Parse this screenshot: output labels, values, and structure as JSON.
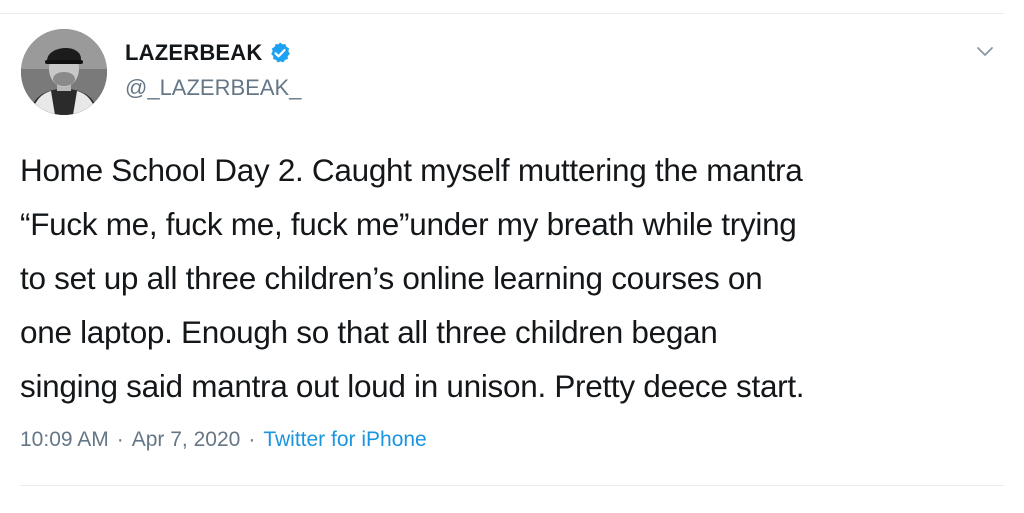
{
  "user": {
    "display_name": "LAZERBEAK",
    "handle": "@_LAZERBEAK_",
    "verified": true
  },
  "tweet": {
    "lines": [
      "Home School Day 2. Caught myself muttering the mantra",
      "“Fuck me, fuck me, fuck me”under my breath while trying",
      "to set up all three children’s online learning courses on",
      "one laptop. Enough so that all three children began",
      "singing said mantra out loud in unison. Pretty deece start."
    ]
  },
  "meta": {
    "time": "10:09 AM",
    "separator": "·",
    "date": "Apr 7, 2020",
    "separator2": "·",
    "source": "Twitter for iPhone"
  },
  "icons": {
    "verified": "verified-badge-icon",
    "menu": "chevron-down-icon"
  },
  "colors": {
    "text": "#14171a",
    "secondary": "#657786",
    "link": "#1b95e0",
    "verified": "#1da1f2",
    "divider": "#e6ecf0"
  }
}
